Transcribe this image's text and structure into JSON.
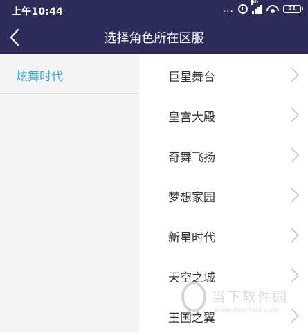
{
  "status_bar": {
    "time": "上午10:44",
    "dots": "...",
    "signal_label": "HD",
    "battery_level": "71"
  },
  "header": {
    "title": "选择角色所在区服"
  },
  "left_panel": {
    "items": [
      {
        "label": "炫舞时代",
        "selected": true
      }
    ]
  },
  "right_panel": {
    "servers": [
      {
        "name": "巨星舞台"
      },
      {
        "name": "皇宫大殿"
      },
      {
        "name": "奇舞飞扬"
      },
      {
        "name": "梦想家园"
      },
      {
        "name": "新星时代"
      },
      {
        "name": "天空之城"
      },
      {
        "name": "王国之翼"
      }
    ]
  },
  "watermark": {
    "name": "当下软件园",
    "url": "www.downxia.com"
  },
  "colors": {
    "header_bg": "#2c2b5a",
    "accent": "#3aa7d8",
    "left_bg": "#f4f4f4",
    "chevron": "#c8c8c8"
  }
}
